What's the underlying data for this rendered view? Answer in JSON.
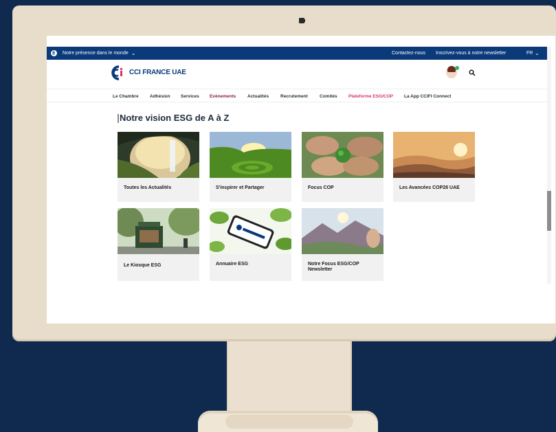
{
  "topbar": {
    "presence": "Notre présence dans le monde",
    "contact": "Contactez-nous",
    "newsletter": "Inscrivez-vous à notre newsletter",
    "lang": "FR"
  },
  "header": {
    "logo_text": "CCI FRANCE UAE",
    "brand_color": "#0a3a7a",
    "accent_color": "#d6336c"
  },
  "nav": {
    "items": [
      "Le Chambre",
      "Adhésion",
      "Services",
      "Evènements",
      "Actualités",
      "Recrutement",
      "Comités",
      "Plateforme ESG/COP",
      "La App CCIFI Connect"
    ]
  },
  "section": {
    "title": "Notre vision ESG de A à Z"
  },
  "cards": [
    {
      "label": "Toutes les Actualités",
      "image": "waterfall-cave-photo"
    },
    {
      "label": "S'inspirer et Partager",
      "image": "green-valley-sunset-photo"
    },
    {
      "label": "Focus COP",
      "image": "hands-holding-earth-photo"
    },
    {
      "label": "Les Avancées COP28 UAE",
      "image": "misty-mountains-sunset-photo"
    },
    {
      "label": "Le Kiosque ESG",
      "image": "park-kiosk-photo"
    },
    {
      "label": "Annuaire ESG",
      "image": "phone-with-leaves-photo"
    },
    {
      "label": "Notre Focus ESG/COP",
      "label2": "Newsletter",
      "image": "mountain-landscape-hand-photo"
    }
  ],
  "icons": {
    "globe": "globe-icon",
    "chevron": "chevron-down-icon",
    "search": "search-icon",
    "avatar": "avatar"
  }
}
